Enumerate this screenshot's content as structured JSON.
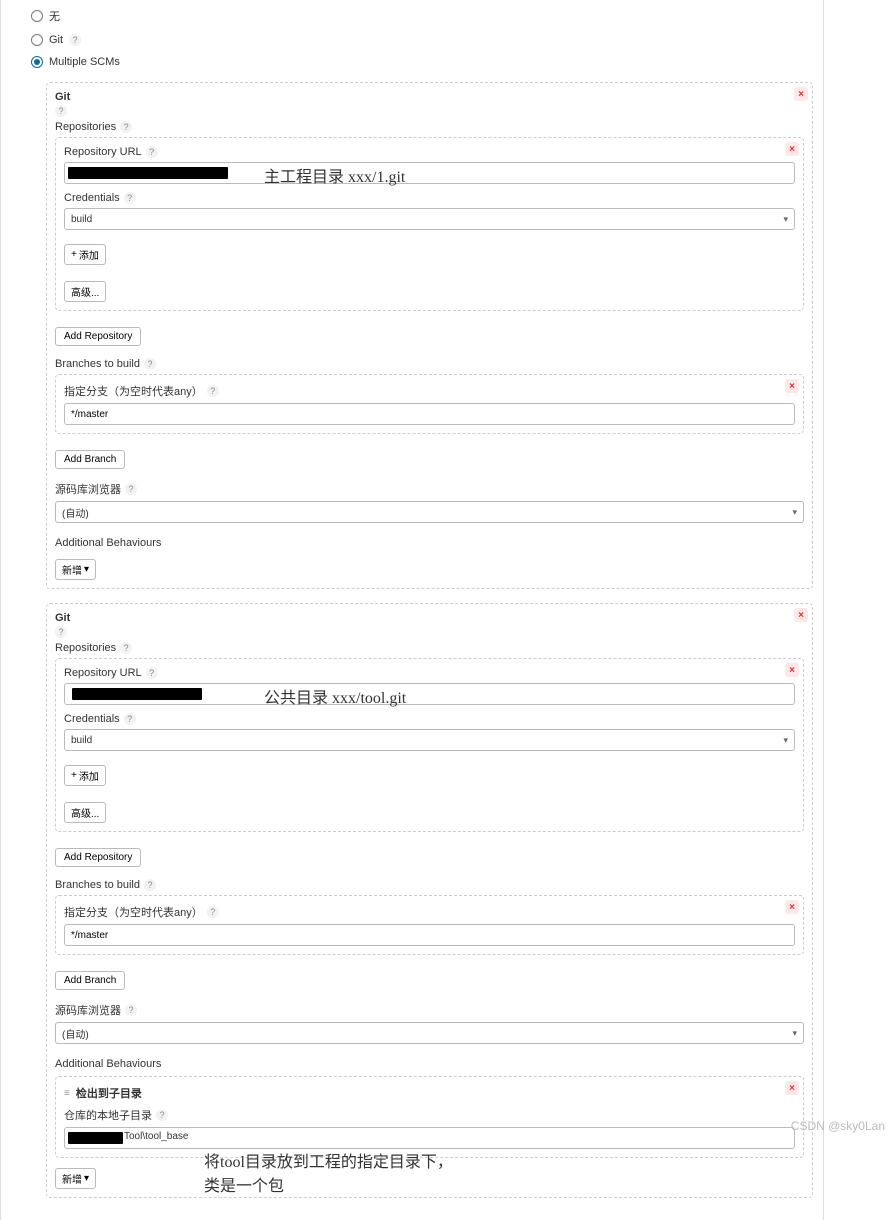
{
  "scm_options": {
    "none": "无",
    "git": "Git",
    "multiple": "Multiple SCMs"
  },
  "scm1": {
    "title": "Git",
    "repos_label": "Repositories",
    "repo_url_label": "Repository URL",
    "repo_annotation": "主工程目录  xxx/1.git",
    "cred_label": "Credentials",
    "cred_value": "build",
    "add_btn": "添加",
    "adv_btn": "高级...",
    "add_repo": "Add Repository",
    "branches_label": "Branches to build",
    "branch_spec_label": "指定分支（为空时代表any）",
    "branch_value": "*/master",
    "add_branch": "Add Branch",
    "browser_label": "源码库浏览器",
    "browser_value": "(自动)",
    "behav_label": "Additional Behaviours",
    "behav_add": "新增"
  },
  "scm2": {
    "title": "Git",
    "repos_label": "Repositories",
    "repo_url_label": "Repository URL",
    "repo_annotation": "公共目录  xxx/tool.git",
    "cred_label": "Credentials",
    "cred_value": "build",
    "add_btn": "添加",
    "adv_btn": "高级...",
    "add_repo": "Add Repository",
    "branches_label": "Branches to build",
    "branch_spec_label": "指定分支（为空时代表any）",
    "branch_value": "*/master",
    "add_branch": "Add Branch",
    "browser_label": "源码库浏览器",
    "browser_value": "(自动)",
    "behav_label": "Additional Behaviours",
    "checkout_title": "检出到子目录",
    "subdir_label": "仓库的本地子目录",
    "subdir_value_suffix": "Tool\\tool_base",
    "subdir_annotation": "将tool目录放到工程的指定目录下，\n类是一个包",
    "behav_add": "新增"
  },
  "watermark": "CSDN @sky0Lan"
}
